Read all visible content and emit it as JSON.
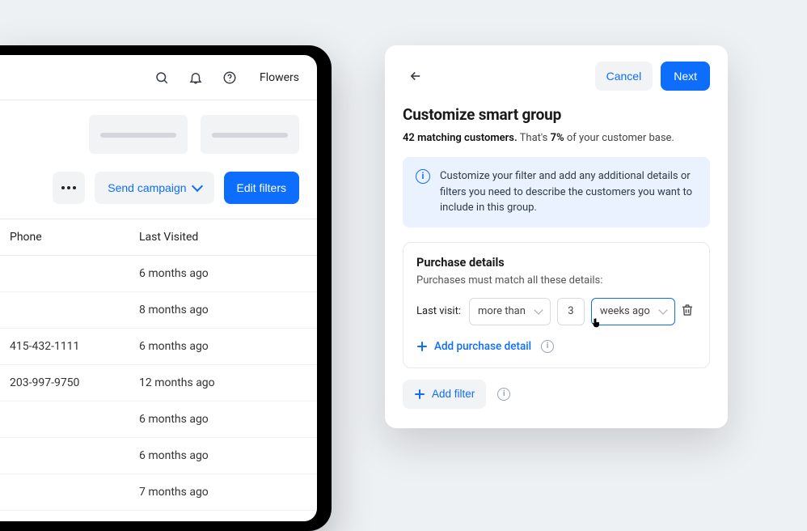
{
  "topbar": {
    "brand": "Flowers"
  },
  "actions": {
    "send_campaign": "Send campaign",
    "edit_filters": "Edit filters"
  },
  "table": {
    "headers": {
      "phone": "Phone",
      "last_visited": "Last Visited"
    },
    "rows": [
      {
        "phone": "",
        "last_visited": "6 months ago"
      },
      {
        "phone": "",
        "last_visited": "8 months ago"
      },
      {
        "phone": "415-432-1111",
        "last_visited": "6 months ago"
      },
      {
        "phone": "203-997-9750",
        "last_visited": "12 months ago"
      },
      {
        "phone": "",
        "last_visited": "6 months ago"
      },
      {
        "phone": "",
        "last_visited": "6 months ago"
      },
      {
        "phone": "",
        "last_visited": "7 months ago"
      }
    ]
  },
  "modal": {
    "cancel": "Cancel",
    "next": "Next",
    "title": "Customize smart group",
    "summary": {
      "count": "42",
      "count_suffix": "matching customers.",
      "pct_prefix": "That's",
      "pct": "7%",
      "pct_suffix": "of your customer base."
    },
    "banner_text": "Customize your filter and add any additional details or filters you need to describe the customers you want to include in this group.",
    "section": {
      "title": "Purchase details",
      "subtitle": "Purchases must match all these details:",
      "row_label": "Last visit:",
      "op": "more than",
      "value": "3",
      "unit": "weeks ago",
      "add_detail": "Add purchase detail"
    },
    "add_filter": "Add filter"
  }
}
